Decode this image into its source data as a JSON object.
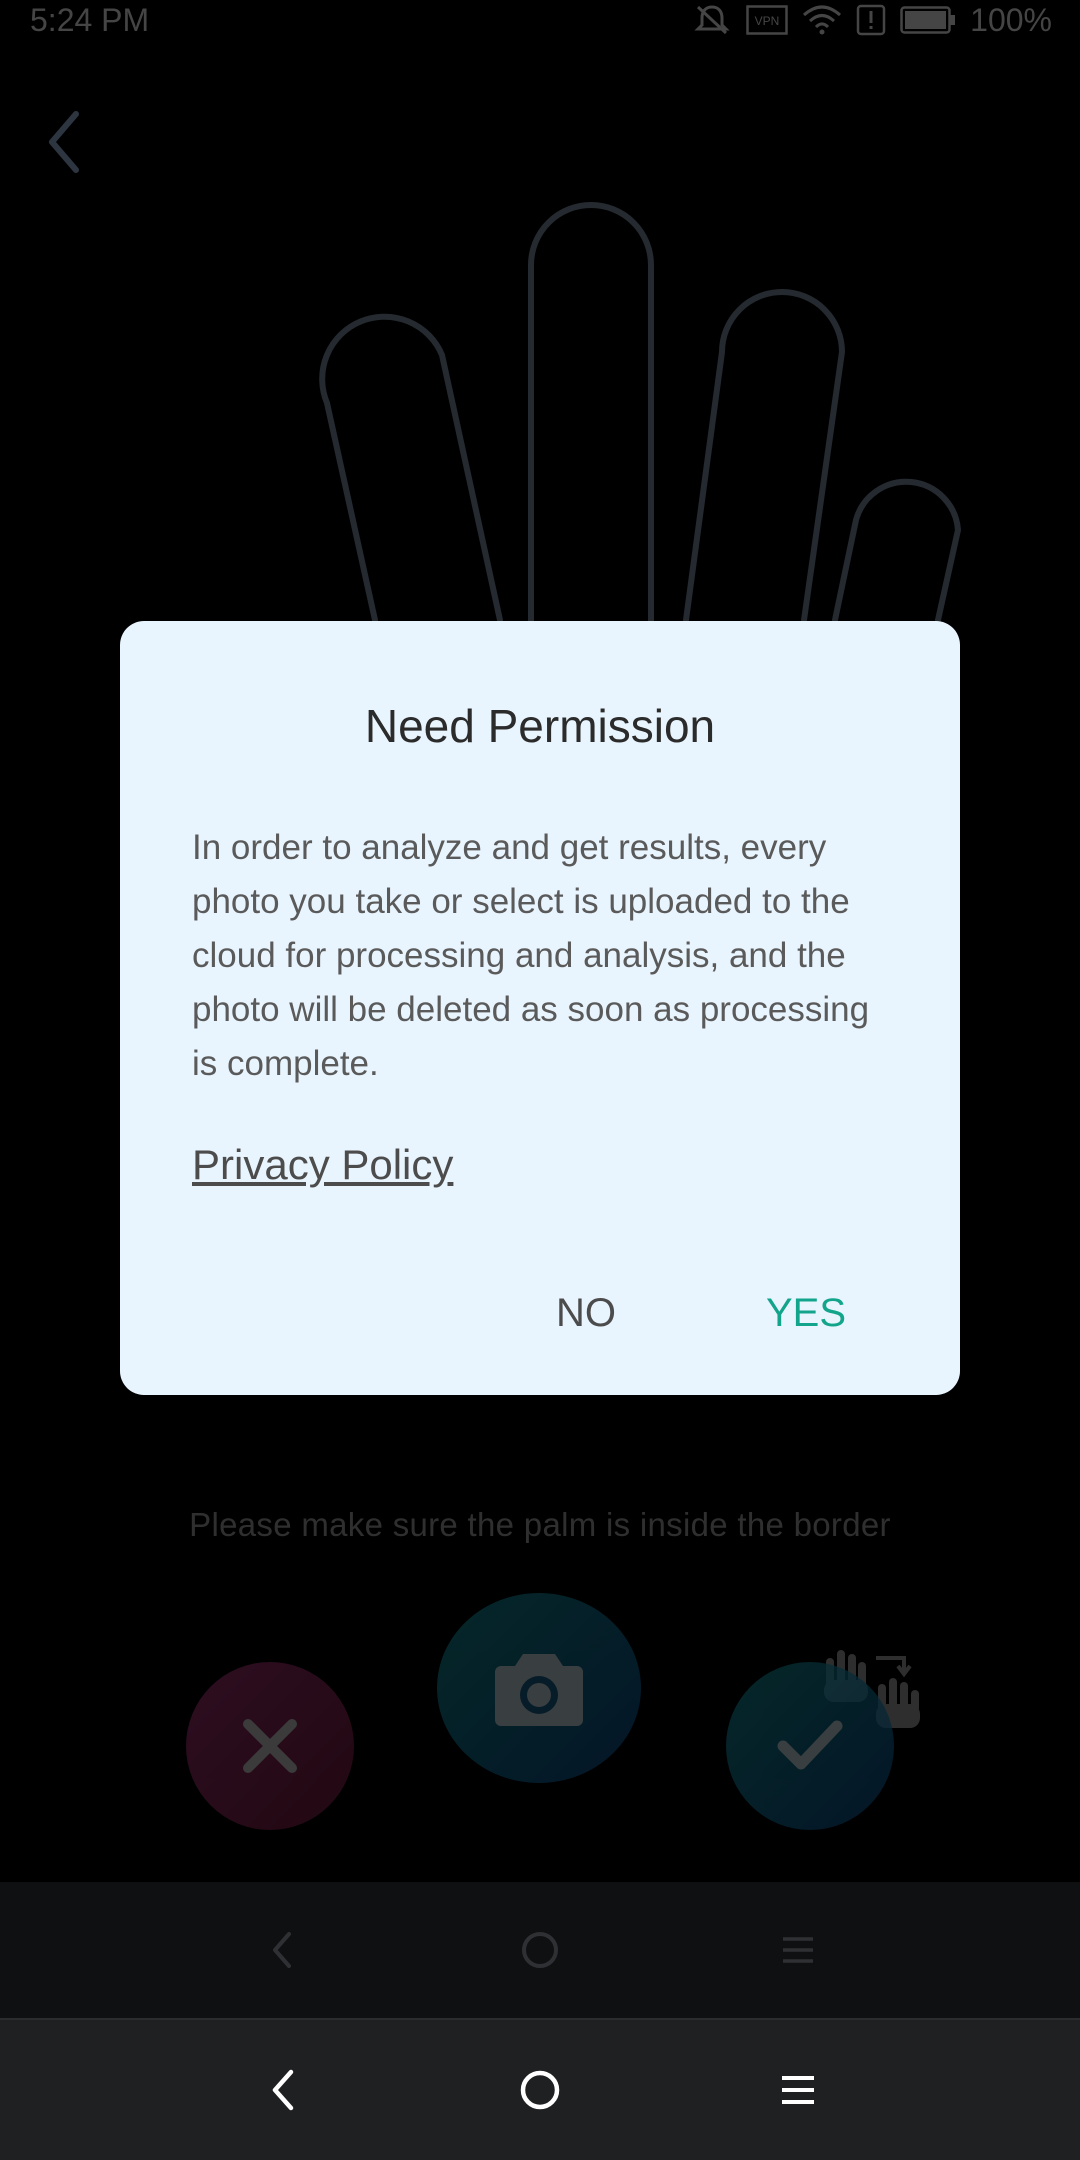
{
  "status_bar": {
    "time": "5:24 PM",
    "vpn_label": "VPN",
    "battery": "100%",
    "icons": [
      "mute-icon",
      "vpn-icon",
      "wifi-icon",
      "alert-icon",
      "battery-icon"
    ]
  },
  "camera": {
    "hint": "Please make sure the palm is inside the border",
    "icons": [
      "back-icon",
      "close-icon",
      "camera-icon",
      "check-icon",
      "switch-hand-icon"
    ]
  },
  "dialog": {
    "title": "Need Permission",
    "body": "In order to analyze and get results, every photo you take or select is uploaded to the cloud for processing and analysis, and the photo will be deleted as soon as processing is complete.",
    "privacy_link": "Privacy Policy",
    "no_label": "NO",
    "yes_label": "YES"
  },
  "colors": {
    "dialog_bg": "#e9f5fe",
    "yes_accent": "#13a58b",
    "cancel_accent": "#a6357a",
    "primary_accent": "#0f6a6e"
  }
}
